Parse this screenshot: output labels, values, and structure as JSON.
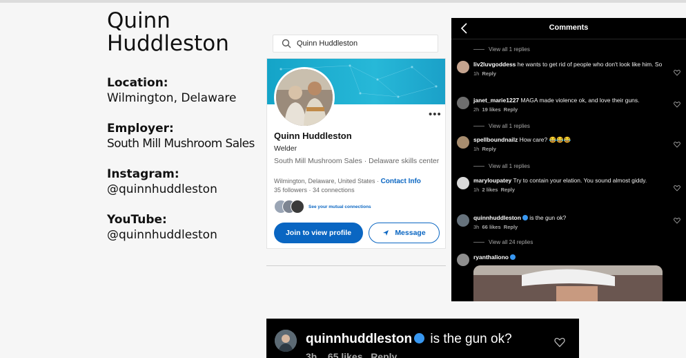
{
  "profile": {
    "name": "Quinn Huddleston",
    "location_label": "Location:",
    "location_value": "Wilmington, Delaware",
    "employer_label": "Employer:",
    "employer_value": "South Mill Mushroom Sales",
    "instagram_label": "Instagram:",
    "instagram_value": "@quinnhuddleston",
    "youtube_label": "YouTube:",
    "youtube_value": "@quinnhuddleston"
  },
  "linkedin": {
    "search_value": "Quinn Huddleston",
    "name": "Quinn Huddleston",
    "title": "Welder",
    "company_line": "South Mill Mushroom Sales  ·  Delaware skills center",
    "location": "Wilmington, Delaware, United States  ·",
    "contact_info": "Contact Info",
    "connections": "35 followers  ·  34 connections",
    "mutual": "See your mutual connections",
    "join_button": "Join to view profile",
    "message_button": "Message",
    "more": "•••",
    "colors": {
      "brand": "#0a66c2",
      "banner": "#1aa6cc"
    }
  },
  "instagram": {
    "title": "Comments",
    "view_replies_1": "View all 1 replies",
    "view_replies_2": "View all 1 replies",
    "view_replies_3": "View all 1 replies",
    "view_replies_4": "View all 24 replies",
    "comments": [
      {
        "user": "liv2luvgoddess",
        "text": " he wants to get rid of people who don't look like him. So",
        "meta_time": "1h",
        "meta_likes": "",
        "reply": "Reply"
      },
      {
        "user": "janet_marie1227",
        "text": " MAGA made violence ok, and love their guns.",
        "meta_time": "2h",
        "meta_likes": "19 likes",
        "reply": "Reply"
      },
      {
        "user": "spellboundnailz",
        "text": " How care? 😂😂😂",
        "meta_time": "1h",
        "meta_likes": "",
        "reply": "Reply"
      },
      {
        "user": "maryloupatey",
        "text": " Try to contain your elation. You sound almost giddy.",
        "meta_time": "1h",
        "meta_likes": "2 likes",
        "reply": "Reply"
      },
      {
        "user": "quinnhuddleston",
        "text": " is the gun ok?",
        "meta_time": "3h",
        "meta_likes": "66 likes",
        "reply": "Reply"
      },
      {
        "user": "ryanthaliono",
        "text": "",
        "meta_time": "",
        "meta_likes": "",
        "reply": ""
      }
    ]
  },
  "zoom_comment": {
    "user": "quinnhuddleston",
    "text": " is the gun ok?",
    "time": "3h",
    "likes": "65 likes",
    "reply": "Reply"
  }
}
